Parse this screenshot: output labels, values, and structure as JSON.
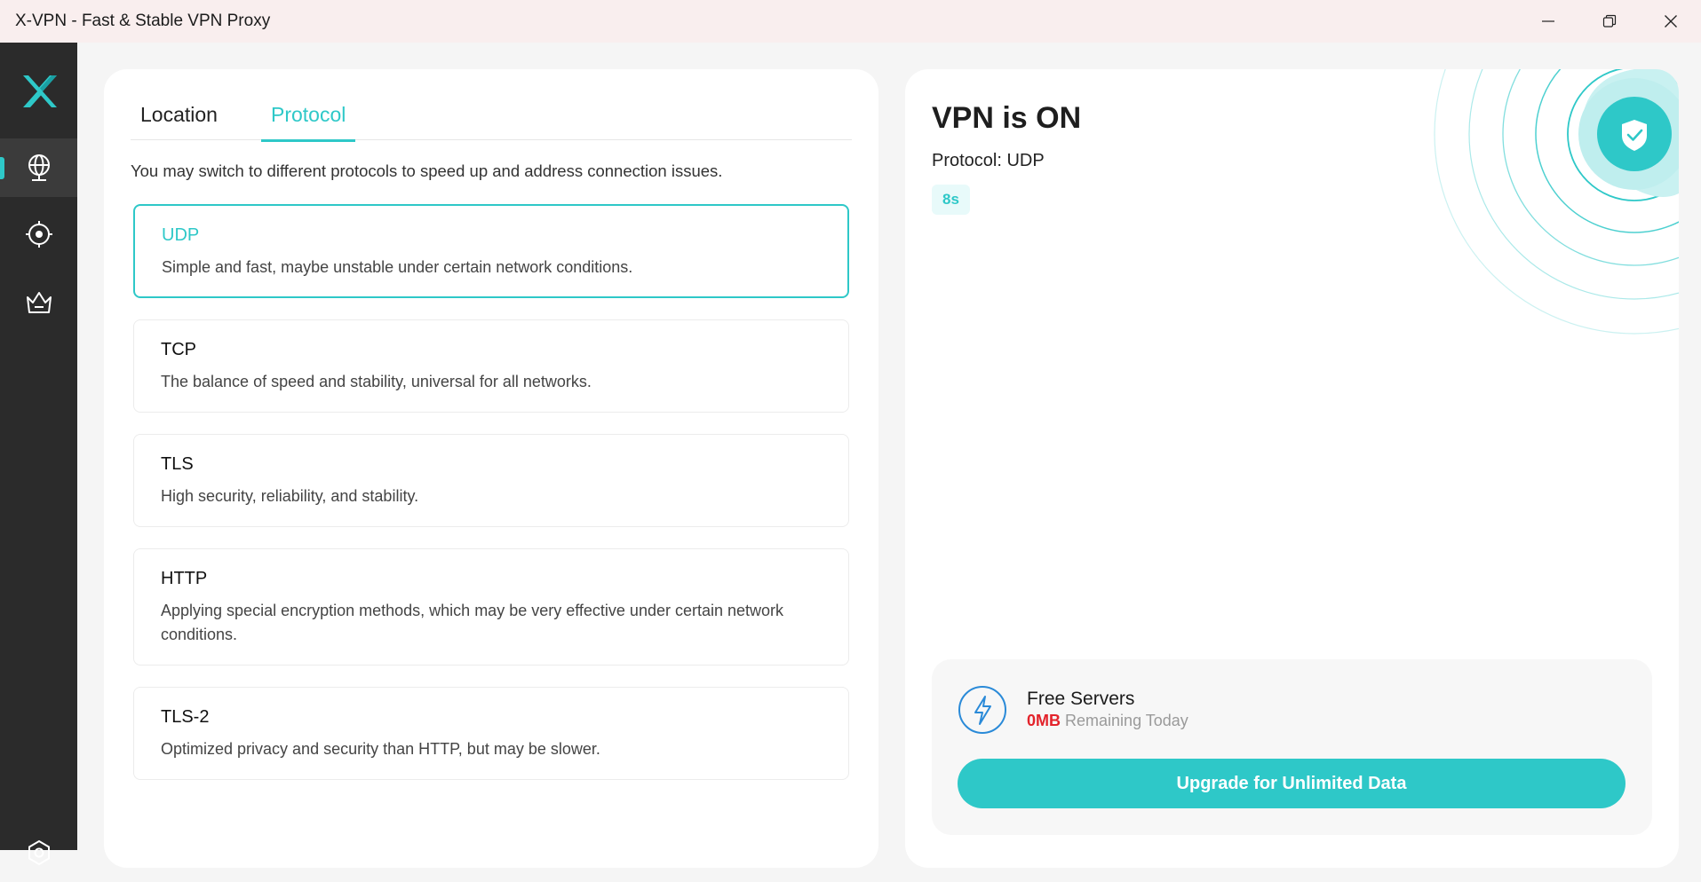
{
  "window": {
    "title": "X-VPN - Fast & Stable VPN Proxy",
    "controls": [
      "minimize-icon",
      "restore-icon",
      "close-icon"
    ]
  },
  "sidebar": {
    "logo": "x-vpn-logo",
    "items": [
      {
        "icon": "globe-icon",
        "active": true
      },
      {
        "icon": "target-icon",
        "active": false
      },
      {
        "icon": "crown-basket-icon",
        "active": false
      },
      {
        "icon": "settings-icon",
        "active": false
      }
    ]
  },
  "tabs": {
    "location": "Location",
    "protocol": "Protocol",
    "active": "protocol"
  },
  "hint": "You may switch to different protocols to speed up and address connection issues.",
  "protocols": [
    {
      "name": "UDP",
      "desc": "Simple and fast, maybe unstable under certain network conditions.",
      "selected": true
    },
    {
      "name": "TCP",
      "desc": "The balance of speed and stability, universal for all networks.",
      "selected": false
    },
    {
      "name": "TLS",
      "desc": "High security, reliability, and stability.",
      "selected": false
    },
    {
      "name": "HTTP",
      "desc": "Applying special encryption methods, which may be very effective under certain network conditions.",
      "selected": false
    },
    {
      "name": "TLS-2",
      "desc": "Optimized privacy and security than HTTP, but may be slower.",
      "selected": false
    }
  ],
  "status": {
    "title": "VPN is ON",
    "protocol_line": "Protocol: UDP",
    "timer": "8s",
    "shield_icon": "shield-check-icon"
  },
  "free": {
    "icon": "lightning-icon",
    "title": "Free Servers",
    "amount": "0MB",
    "remaining": "Remaining Today",
    "upgrade_label": "Upgrade for Unlimited Data"
  },
  "colors": {
    "accent": "#2ec8c8",
    "sidebar": "#2b2b2b",
    "titlebar": "#f9eeee",
    "warning": "#e3232b"
  }
}
